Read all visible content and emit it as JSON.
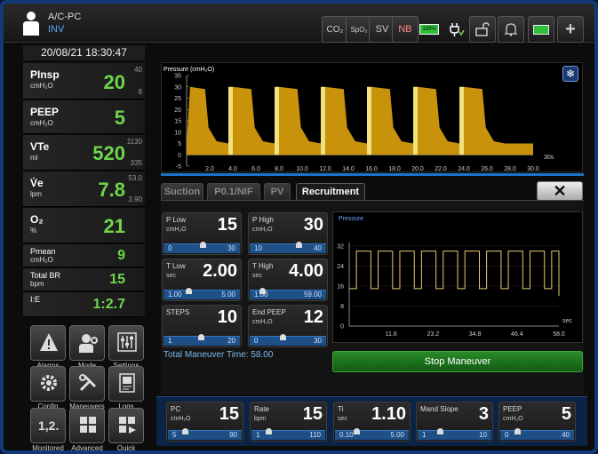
{
  "header": {
    "mode": "A/C-PC",
    "mode_sub": "INV",
    "buttons": [
      {
        "name": "co2-button",
        "label": "CO₂"
      },
      {
        "name": "spo2-button",
        "label": "SpO₂"
      },
      {
        "name": "sv-button",
        "label": "SV"
      },
      {
        "name": "nb-button",
        "label": "NB"
      },
      {
        "name": "battery-icon",
        "label": "100%"
      },
      {
        "name": "power-plug-icon",
        "label": ""
      },
      {
        "name": "unlock-button",
        "label": ""
      },
      {
        "name": "alarm-bell-button",
        "label": ""
      },
      {
        "name": "screen-button",
        "label": ""
      },
      {
        "name": "add-button",
        "label": "+"
      }
    ]
  },
  "datetime": "20/08/21 18:30:47",
  "parameters": [
    {
      "name": "PInsp",
      "unit": "cmH₂O",
      "value": "20",
      "high": "40",
      "low": "8"
    },
    {
      "name": "PEEP",
      "unit": "cmH₂O",
      "value": "5",
      "high": "",
      "low": ""
    },
    {
      "name": "VTe",
      "unit": "ml",
      "value": "520",
      "high": "1130",
      "low": "335"
    },
    {
      "name": "V̇e",
      "unit": "lpm",
      "value": "7.8",
      "high": "53.0",
      "low": "3.90"
    },
    {
      "name": "O₂",
      "unit": "%",
      "value": "21",
      "high": "",
      "low": ""
    },
    {
      "name": "Pmean",
      "unit": "cmH₂O",
      "value": "9",
      "high": "",
      "low": ""
    },
    {
      "name": "Total BR",
      "unit": "bpm",
      "value": "15",
      "high": "",
      "low": ""
    },
    {
      "name": "I:E",
      "unit": "",
      "value": "1:2.7",
      "high": "",
      "low": ""
    }
  ],
  "nav_buttons": [
    {
      "name": "alarms-button",
      "label": "Alarms"
    },
    {
      "name": "mode-button",
      "label": "Mode"
    },
    {
      "name": "settings-button",
      "label": "Settings"
    },
    {
      "name": "config-button",
      "label": "Config"
    },
    {
      "name": "maneuvers-button",
      "label": "Maneuvers"
    },
    {
      "name": "logs-button",
      "label": "Logs"
    },
    {
      "name": "monitored-button",
      "label": "Monitored",
      "glyph": "1,2..."
    },
    {
      "name": "advanced-button",
      "label": "Advanced"
    },
    {
      "name": "quick-button",
      "label": "Quick"
    }
  ],
  "waveform": {
    "title": "Pressure (cmH₂O)",
    "y_ticks": [
      "35",
      "30",
      "25",
      "20",
      "15",
      "10",
      "5",
      "0",
      "-5"
    ],
    "x_ticks": [
      "2.0",
      "4.0",
      "6.0",
      "8.0",
      "10.0",
      "12.0",
      "14.0",
      "16.0",
      "18.0",
      "20.0",
      "22.0",
      "24.0",
      "26.0",
      "28.0",
      "30.0"
    ],
    "x_unit": "30s",
    "waveform_color": "#c8920a",
    "highlight_color": "#f0e080"
  },
  "tabs": [
    "Suction",
    "P0.1/NIF",
    "PV",
    "Recruitment"
  ],
  "active_tab": "Recruitment",
  "close_label": "✕",
  "recruitment": {
    "settings": [
      {
        "id": "p-low",
        "name": "P Low",
        "unit": "cmH₂O",
        "value": "15",
        "min": "0",
        "max": "30",
        "level": 0.5
      },
      {
        "id": "p-high",
        "name": "P High",
        "unit": "cmH₂O",
        "value": "30",
        "min": "10",
        "max": "40",
        "level": 0.67
      },
      {
        "id": "t-low",
        "name": "T Low",
        "unit": "sec",
        "value": "2.00",
        "min": "1.00",
        "max": "5.00",
        "level": 0.25
      },
      {
        "id": "t-high",
        "name": "T High",
        "unit": "sec",
        "value": "4.00",
        "min": "1.00",
        "max": "59.00",
        "level": 0.05
      },
      {
        "id": "steps",
        "name": "STEPS",
        "unit": "",
        "value": "10",
        "min": "1",
        "max": "20",
        "level": 0.47
      },
      {
        "id": "end-peep",
        "name": "End PEEP",
        "unit": "cmH₂O",
        "value": "12",
        "min": "0",
        "max": "30",
        "level": 0.4
      }
    ],
    "total_time_label": "Total Maneuver Time: 58.00",
    "stop_label": "Stop Maneuver",
    "pressure_chart": {
      "title": "Pressure",
      "y_ticks": [
        "32",
        "24",
        "16",
        "8",
        "0"
      ],
      "x_ticks": [
        "11.6",
        "23.2",
        "34.8",
        "46.4",
        "58.0"
      ],
      "x_unit": "sec",
      "line_color": "#e8c870"
    }
  },
  "bottom_settings": [
    {
      "id": "pc",
      "name": "PC",
      "unit": "cmH₂O",
      "value": "15",
      "min": "5",
      "max": "90",
      "level": 0.12
    },
    {
      "id": "rate",
      "name": "Rate",
      "unit": "bpm",
      "value": "15",
      "min": "1",
      "max": "110",
      "level": 0.13
    },
    {
      "id": "ti",
      "name": "Ti",
      "unit": "sec",
      "value": "1.10",
      "min": "0.10",
      "max": "5.00",
      "level": 0.2
    },
    {
      "id": "mand-slope",
      "name": "Mand Slope",
      "unit": "",
      "value": "3",
      "min": "1",
      "max": "10",
      "level": 0.22
    },
    {
      "id": "peep",
      "name": "PEEP",
      "unit": "cmH₂O",
      "value": "5",
      "min": "0",
      "max": "40",
      "level": 0.13
    }
  ]
}
